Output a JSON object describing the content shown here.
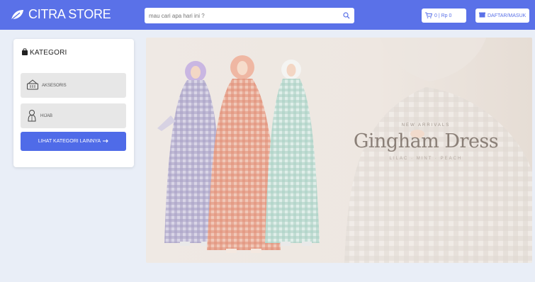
{
  "header": {
    "brand_name": "CITRA STORE",
    "search_placeholder": "mau cari apa hari ini ?",
    "cart_label": "0 | Rp 0",
    "login_label": "DAFTAR/MASUK"
  },
  "sidebar": {
    "title": "KATEGORI",
    "items": [
      {
        "label": "AKSESORIS",
        "icon": "basket-icon"
      },
      {
        "label": "HIJAB",
        "icon": "hijab-icon"
      }
    ],
    "more_button": "LIHAT KATEGORI LAINNYA"
  },
  "banner": {
    "eyebrow": "NEW ARRIVALS",
    "headline": "Gingham Dress",
    "subline": "LILAC · MINT · PEACH"
  },
  "colors": {
    "primary": "#5a71e8",
    "button": "#4f6be8",
    "background": "#e9eef7",
    "category_bg": "#e7e7e7"
  }
}
